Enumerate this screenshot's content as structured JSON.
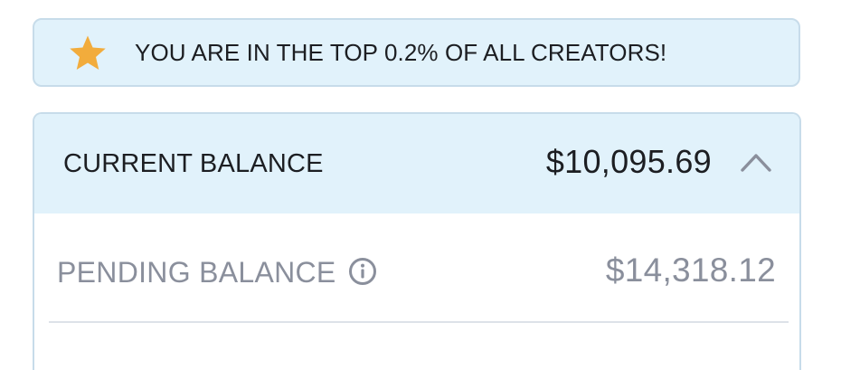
{
  "banner": {
    "icon": "star-icon",
    "text": "YOU ARE IN THE TOP 0.2% OF ALL CREATORS!"
  },
  "balance_card": {
    "current_label": "CURRENT BALANCE",
    "current_amount": "$10,095.69",
    "toggle_icon": "chevron-up-icon",
    "pending_label": "PENDING BALANCE",
    "pending_info_icon": "info-icon",
    "pending_amount": "$14,318.12"
  },
  "colors": {
    "star": "#f2ac3c",
    "highlight_bg": "#e1f2fb",
    "border": "#c7dcea",
    "primary_text": "#1c1e22",
    "muted_text": "#8a8f9c"
  }
}
